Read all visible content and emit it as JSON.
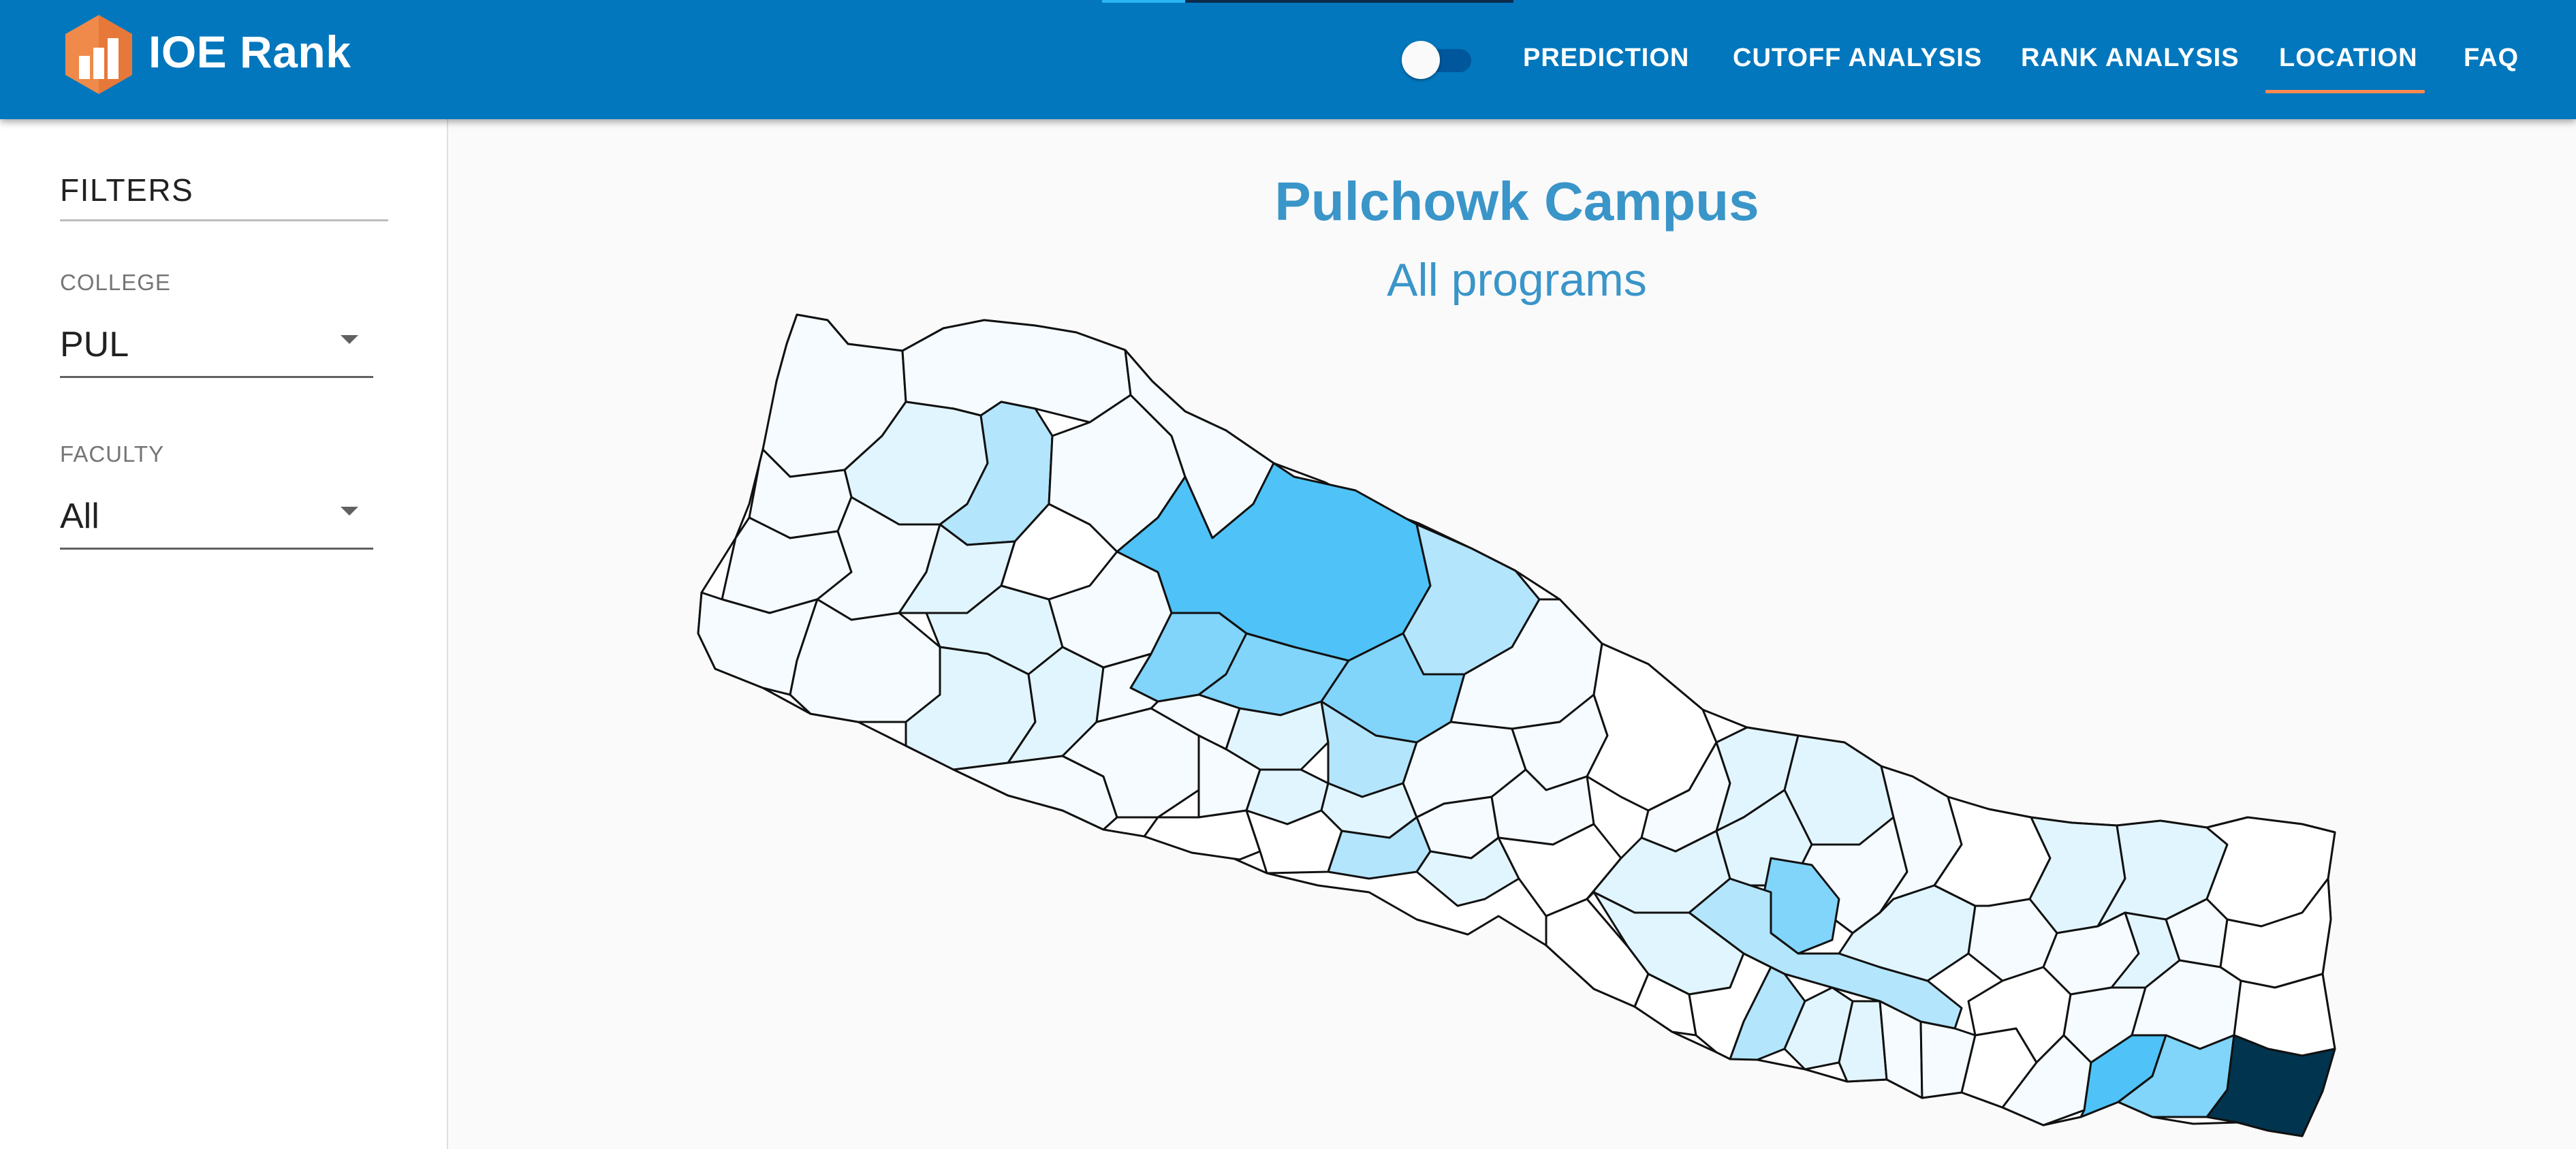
{
  "app": {
    "brand": "IOE Rank",
    "nav": [
      {
        "label": "PREDICTION"
      },
      {
        "label": "CUTOFF ANALYSIS"
      },
      {
        "label": "RANK ANALYSIS"
      },
      {
        "label": "LOCATION",
        "active": true
      },
      {
        "label": "FAQ"
      }
    ],
    "theme_toggle": {
      "on": false
    },
    "colors": {
      "appbar": "#0277bd",
      "accent": "#ff8a50",
      "title": "#3a95c9"
    }
  },
  "filters": {
    "title": "FILTERS",
    "college": {
      "label": "COLLEGE",
      "value": "PUL"
    },
    "faculty": {
      "label": "FACULTY",
      "value": "All"
    }
  },
  "main": {
    "title": "Pulchowk Campus",
    "subtitle": "All programs"
  },
  "map": {
    "type": "choropleth",
    "region": "Nepal districts",
    "color_scale": [
      "#ffffff",
      "#e1f5fe",
      "#b3e5fc",
      "#4fc3f7",
      "#01344f"
    ]
  }
}
